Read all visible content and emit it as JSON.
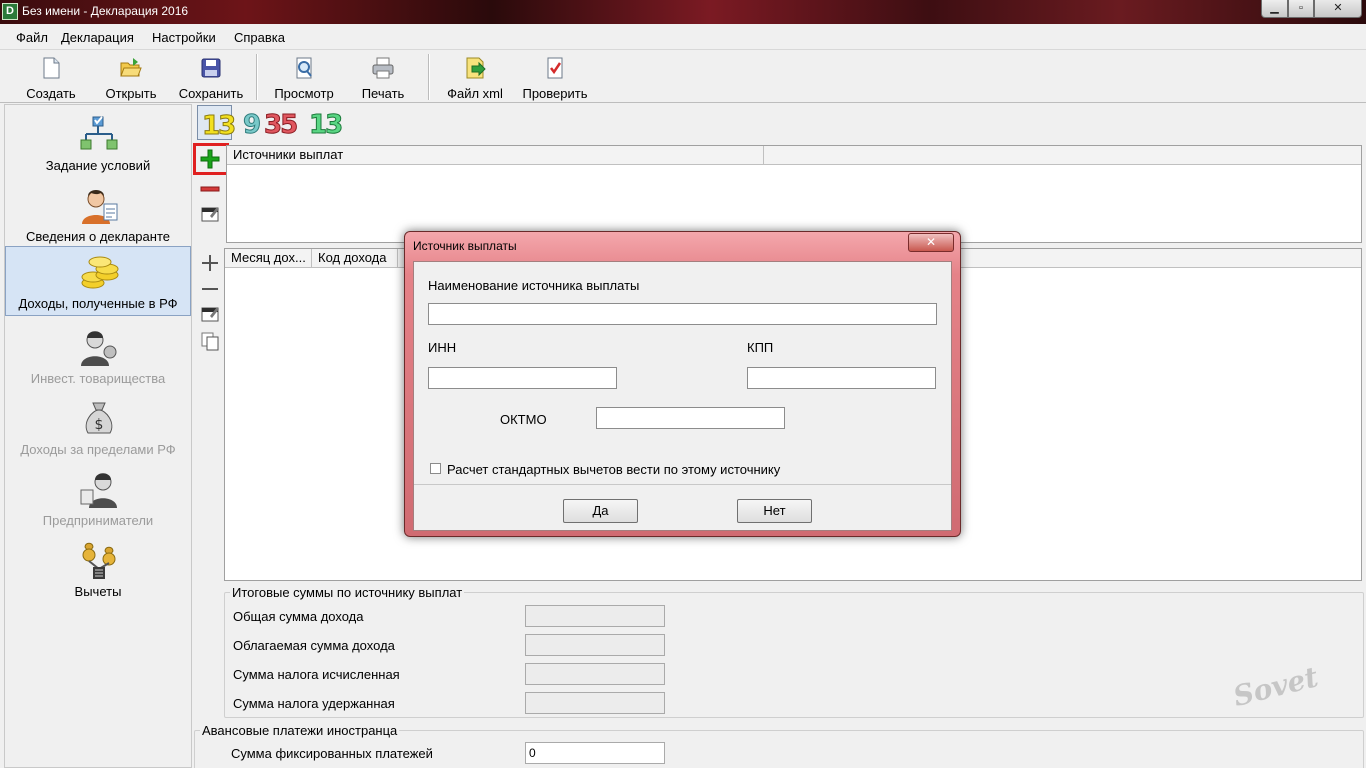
{
  "window": {
    "title": "Без имени - Декларация 2016",
    "controls": {
      "minimize": "▁",
      "maximize": "▫",
      "close": "✕"
    }
  },
  "menu": [
    "Файл",
    "Декларация",
    "Настройки",
    "Справка"
  ],
  "toolbar": {
    "create": "Создать",
    "open": "Открыть",
    "save": "Сохранить",
    "preview": "Просмотр",
    "print": "Печать",
    "xml": "Файл xml",
    "check": "Проверить"
  },
  "sidebar": {
    "items": [
      {
        "label": "Задание условий",
        "icon": "conditions-icon",
        "enabled": true,
        "active": false
      },
      {
        "label": "Сведения о декларанте",
        "icon": "declarant-icon",
        "enabled": true,
        "active": false
      },
      {
        "label": "Доходы, полученные в РФ",
        "icon": "coins-icon",
        "enabled": true,
        "active": true
      },
      {
        "label": "Инвест. товарищества",
        "icon": "investor-icon",
        "enabled": false,
        "active": false
      },
      {
        "label": "Доходы за пределами РФ",
        "icon": "money-bag-icon",
        "enabled": false,
        "active": false
      },
      {
        "label": "Предприниматели",
        "icon": "entrepreneur-icon",
        "enabled": false,
        "active": false
      },
      {
        "label": "Вычеты",
        "icon": "deductions-icon",
        "enabled": true,
        "active": false
      }
    ]
  },
  "rate_tabs": [
    {
      "label": "13",
      "color": "#f2e020"
    },
    {
      "label": "9",
      "color": "#79c9c9"
    },
    {
      "label": "35",
      "color": "#e0575f"
    },
    {
      "label": "13",
      "color": "#5ad684"
    }
  ],
  "sources_grid": {
    "columns": [
      "Источники выплат"
    ]
  },
  "income_grid": {
    "columns": [
      "Месяц дох...",
      "Код дохода"
    ]
  },
  "totals": {
    "title": "Итоговые суммы по источнику выплат",
    "rows": [
      {
        "label": "Общая сумма дохода",
        "value": ""
      },
      {
        "label": "Облагаемая сумма дохода",
        "value": ""
      },
      {
        "label": "Сумма налога исчисленная",
        "value": ""
      },
      {
        "label": "Сумма налога удержанная",
        "value": ""
      }
    ]
  },
  "advance": {
    "title": "Авансовые платежи иностранца",
    "fixed_label": "Сумма фиксированных платежей",
    "fixed_value": "0"
  },
  "dialog": {
    "title": "Источник выплаты",
    "close": "✕",
    "name_label": "Наименование источника выплаты",
    "name_value": "",
    "inn_label": "ИНН",
    "inn_value": "",
    "kpp_label": "КПП",
    "kpp_value": "",
    "oktmo_label": "ОКТМО",
    "oktmo_value": "",
    "checkbox_label": "Расчет стандартных вычетов вести по этому источнику",
    "checkbox_checked": false,
    "yes": "Да",
    "no": "Нет"
  },
  "watermark": "Sovet",
  "colors": {
    "accent_red": "#e02020",
    "add_green": "#1aa31a",
    "selected_nav": "#d6e4f5"
  }
}
